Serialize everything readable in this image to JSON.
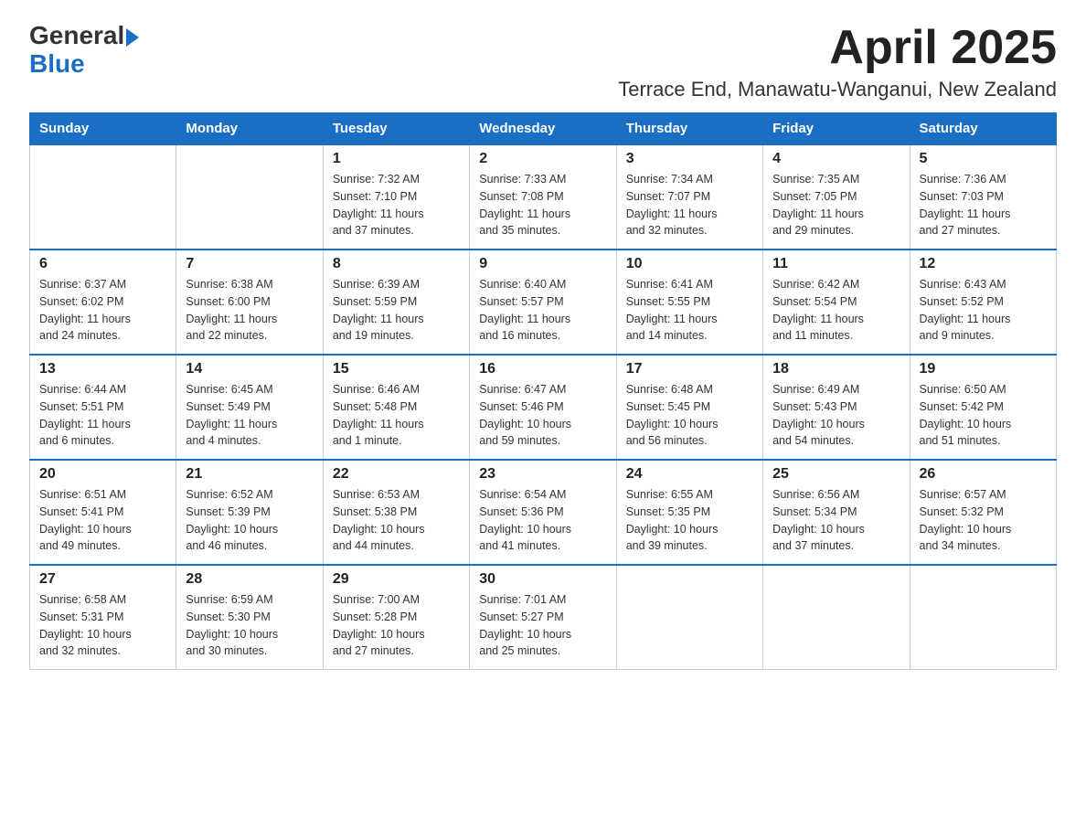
{
  "header": {
    "logo": {
      "general": "General",
      "blue": "Blue"
    },
    "month": "April 2025",
    "location": "Terrace End, Manawatu-Wanganui, New Zealand"
  },
  "days_of_week": [
    "Sunday",
    "Monday",
    "Tuesday",
    "Wednesday",
    "Thursday",
    "Friday",
    "Saturday"
  ],
  "weeks": [
    [
      {
        "day": "",
        "info": ""
      },
      {
        "day": "",
        "info": ""
      },
      {
        "day": "1",
        "info": "Sunrise: 7:32 AM\nSunset: 7:10 PM\nDaylight: 11 hours\nand 37 minutes."
      },
      {
        "day": "2",
        "info": "Sunrise: 7:33 AM\nSunset: 7:08 PM\nDaylight: 11 hours\nand 35 minutes."
      },
      {
        "day": "3",
        "info": "Sunrise: 7:34 AM\nSunset: 7:07 PM\nDaylight: 11 hours\nand 32 minutes."
      },
      {
        "day": "4",
        "info": "Sunrise: 7:35 AM\nSunset: 7:05 PM\nDaylight: 11 hours\nand 29 minutes."
      },
      {
        "day": "5",
        "info": "Sunrise: 7:36 AM\nSunset: 7:03 PM\nDaylight: 11 hours\nand 27 minutes."
      }
    ],
    [
      {
        "day": "6",
        "info": "Sunrise: 6:37 AM\nSunset: 6:02 PM\nDaylight: 11 hours\nand 24 minutes."
      },
      {
        "day": "7",
        "info": "Sunrise: 6:38 AM\nSunset: 6:00 PM\nDaylight: 11 hours\nand 22 minutes."
      },
      {
        "day": "8",
        "info": "Sunrise: 6:39 AM\nSunset: 5:59 PM\nDaylight: 11 hours\nand 19 minutes."
      },
      {
        "day": "9",
        "info": "Sunrise: 6:40 AM\nSunset: 5:57 PM\nDaylight: 11 hours\nand 16 minutes."
      },
      {
        "day": "10",
        "info": "Sunrise: 6:41 AM\nSunset: 5:55 PM\nDaylight: 11 hours\nand 14 minutes."
      },
      {
        "day": "11",
        "info": "Sunrise: 6:42 AM\nSunset: 5:54 PM\nDaylight: 11 hours\nand 11 minutes."
      },
      {
        "day": "12",
        "info": "Sunrise: 6:43 AM\nSunset: 5:52 PM\nDaylight: 11 hours\nand 9 minutes."
      }
    ],
    [
      {
        "day": "13",
        "info": "Sunrise: 6:44 AM\nSunset: 5:51 PM\nDaylight: 11 hours\nand 6 minutes."
      },
      {
        "day": "14",
        "info": "Sunrise: 6:45 AM\nSunset: 5:49 PM\nDaylight: 11 hours\nand 4 minutes."
      },
      {
        "day": "15",
        "info": "Sunrise: 6:46 AM\nSunset: 5:48 PM\nDaylight: 11 hours\nand 1 minute."
      },
      {
        "day": "16",
        "info": "Sunrise: 6:47 AM\nSunset: 5:46 PM\nDaylight: 10 hours\nand 59 minutes."
      },
      {
        "day": "17",
        "info": "Sunrise: 6:48 AM\nSunset: 5:45 PM\nDaylight: 10 hours\nand 56 minutes."
      },
      {
        "day": "18",
        "info": "Sunrise: 6:49 AM\nSunset: 5:43 PM\nDaylight: 10 hours\nand 54 minutes."
      },
      {
        "day": "19",
        "info": "Sunrise: 6:50 AM\nSunset: 5:42 PM\nDaylight: 10 hours\nand 51 minutes."
      }
    ],
    [
      {
        "day": "20",
        "info": "Sunrise: 6:51 AM\nSunset: 5:41 PM\nDaylight: 10 hours\nand 49 minutes."
      },
      {
        "day": "21",
        "info": "Sunrise: 6:52 AM\nSunset: 5:39 PM\nDaylight: 10 hours\nand 46 minutes."
      },
      {
        "day": "22",
        "info": "Sunrise: 6:53 AM\nSunset: 5:38 PM\nDaylight: 10 hours\nand 44 minutes."
      },
      {
        "day": "23",
        "info": "Sunrise: 6:54 AM\nSunset: 5:36 PM\nDaylight: 10 hours\nand 41 minutes."
      },
      {
        "day": "24",
        "info": "Sunrise: 6:55 AM\nSunset: 5:35 PM\nDaylight: 10 hours\nand 39 minutes."
      },
      {
        "day": "25",
        "info": "Sunrise: 6:56 AM\nSunset: 5:34 PM\nDaylight: 10 hours\nand 37 minutes."
      },
      {
        "day": "26",
        "info": "Sunrise: 6:57 AM\nSunset: 5:32 PM\nDaylight: 10 hours\nand 34 minutes."
      }
    ],
    [
      {
        "day": "27",
        "info": "Sunrise: 6:58 AM\nSunset: 5:31 PM\nDaylight: 10 hours\nand 32 minutes."
      },
      {
        "day": "28",
        "info": "Sunrise: 6:59 AM\nSunset: 5:30 PM\nDaylight: 10 hours\nand 30 minutes."
      },
      {
        "day": "29",
        "info": "Sunrise: 7:00 AM\nSunset: 5:28 PM\nDaylight: 10 hours\nand 27 minutes."
      },
      {
        "day": "30",
        "info": "Sunrise: 7:01 AM\nSunset: 5:27 PM\nDaylight: 10 hours\nand 25 minutes."
      },
      {
        "day": "",
        "info": ""
      },
      {
        "day": "",
        "info": ""
      },
      {
        "day": "",
        "info": ""
      }
    ]
  ]
}
